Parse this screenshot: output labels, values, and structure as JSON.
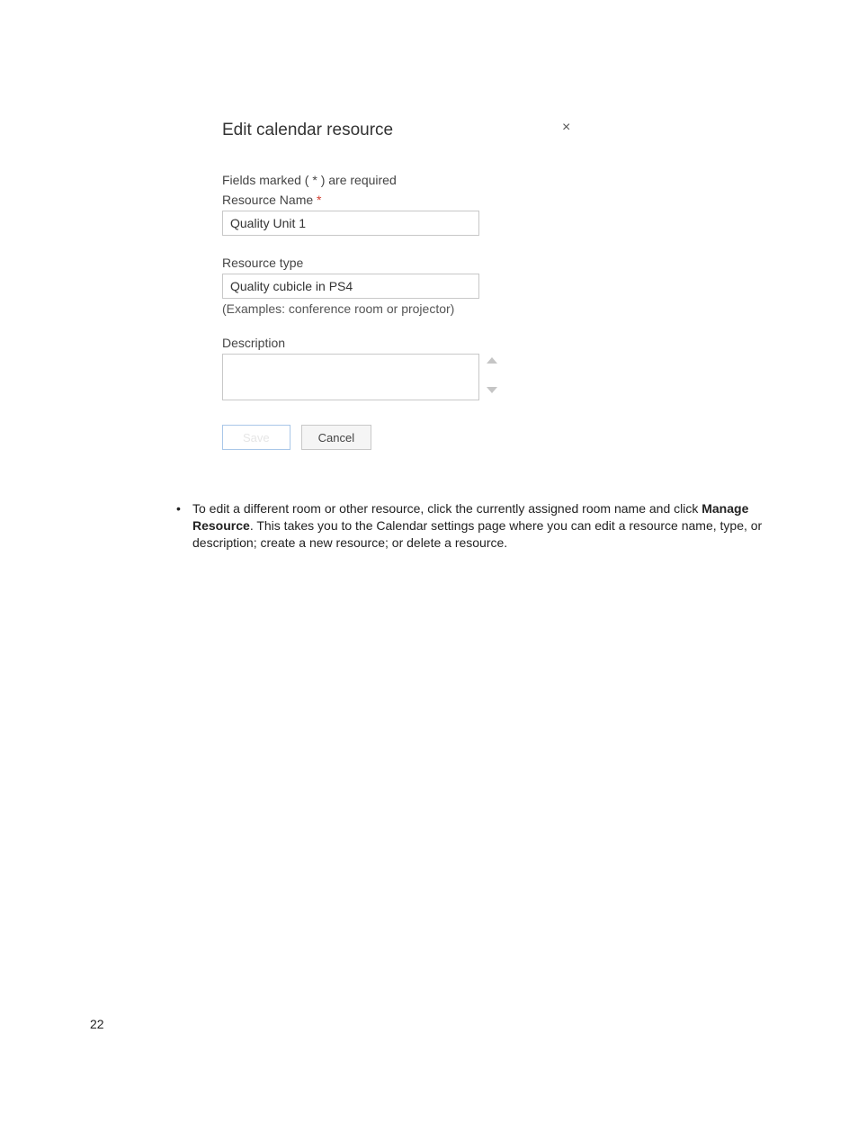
{
  "dialog": {
    "title": "Edit calendar resource",
    "required_note": "Fields marked ( * ) are required",
    "name_label": "Resource Name",
    "name_star": "*",
    "name_value": "Quality Unit 1",
    "type_label": "Resource type",
    "type_value": "Quality cubicle in PS4",
    "type_hint": "(Examples: conference room or projector)",
    "desc_label": "Description",
    "desc_value": "",
    "save_label": "Save",
    "cancel_label": "Cancel"
  },
  "help": {
    "bullet": "•",
    "text_before": "To edit a different room or other resource, click the currently assigned room name and click ",
    "strong": "Manage Resource",
    "text_after": ". This takes you to the Calendar settings page where you can edit a resource name, type, or description; create a new resource; or delete a resource."
  },
  "page_number": "22"
}
